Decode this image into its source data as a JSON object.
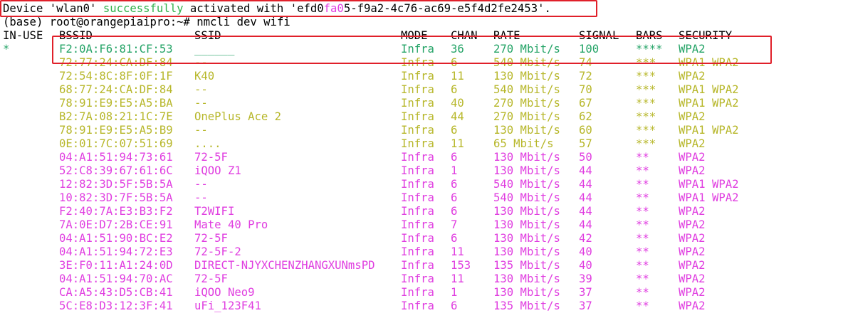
{
  "colors": {
    "default_text": "#000000",
    "success_green": "#2fb24a",
    "active_row_green": "#23a366",
    "weak_signal_yellow": "#b7b72a",
    "low_signal_magenta": "#e03ee0",
    "highlight_red": "#e0202a"
  },
  "terminal": {
    "status_line": {
      "prefix": "Device 'wlan0' ",
      "highlight_word": "successfully",
      "middle": " activated with 'efd0",
      "uuid_magenta": "fa0",
      "uuid_rest": "5-f9a2-4c76-ac69-e5f4d2fe2453'."
    },
    "prompt": "(base) root@orangepiaipro:~# nmcli dev wifi",
    "headers": [
      "IN-USE",
      "BSSID",
      "SSID",
      "MODE",
      "CHAN",
      "RATE",
      "SIGNAL",
      "BARS",
      "SECURITY"
    ],
    "rows": [
      {
        "inuse": "*",
        "bssid": "F2:0A:F6:81:CF:53",
        "ssid": "______",
        "mode": "Infra",
        "chan": "36",
        "rate": "270 Mbit/s",
        "signal": "100",
        "bars": "****",
        "security": "WPA2",
        "tone": "active"
      },
      {
        "inuse": "",
        "bssid": "72:77:24:CA:DF:84",
        "ssid": "--",
        "mode": "Infra",
        "chan": "6",
        "rate": "540 Mbit/s",
        "signal": "74",
        "bars": "***",
        "security": "WPA1 WPA2",
        "tone": "yellow"
      },
      {
        "inuse": "",
        "bssid": "72:54:8C:8F:0F:1F",
        "ssid": "K40",
        "mode": "Infra",
        "chan": "11",
        "rate": "130 Mbit/s",
        "signal": "72",
        "bars": "***",
        "security": "WPA2",
        "tone": "yellow"
      },
      {
        "inuse": "",
        "bssid": "68:77:24:CA:DF:84",
        "ssid": "--",
        "mode": "Infra",
        "chan": "6",
        "rate": "540 Mbit/s",
        "signal": "70",
        "bars": "***",
        "security": "WPA1 WPA2",
        "tone": "yellow"
      },
      {
        "inuse": "",
        "bssid": "78:91:E9:E5:A5:BA",
        "ssid": "--",
        "mode": "Infra",
        "chan": "40",
        "rate": "270 Mbit/s",
        "signal": "67",
        "bars": "***",
        "security": "WPA1 WPA2",
        "tone": "yellow"
      },
      {
        "inuse": "",
        "bssid": "B2:7A:08:21:1C:7E",
        "ssid": "OnePlus Ace 2",
        "mode": "Infra",
        "chan": "44",
        "rate": "270 Mbit/s",
        "signal": "62",
        "bars": "***",
        "security": "WPA2",
        "tone": "yellow"
      },
      {
        "inuse": "",
        "bssid": "78:91:E9:E5:A5:B9",
        "ssid": "--",
        "mode": "Infra",
        "chan": "6",
        "rate": "130 Mbit/s",
        "signal": "60",
        "bars": "***",
        "security": "WPA1 WPA2",
        "tone": "yellow"
      },
      {
        "inuse": "",
        "bssid": "0E:01:7C:07:51:69",
        "ssid": "....",
        "mode": "Infra",
        "chan": "11",
        "rate": "65 Mbit/s",
        "signal": "57",
        "bars": "***",
        "security": "WPA2",
        "tone": "yellow"
      },
      {
        "inuse": "",
        "bssid": "04:A1:51:94:73:61",
        "ssid": "72-5F",
        "mode": "Infra",
        "chan": "6",
        "rate": "130 Mbit/s",
        "signal": "50",
        "bars": "**",
        "security": "WPA2",
        "tone": "magenta"
      },
      {
        "inuse": "",
        "bssid": "52:C8:39:67:61:6C",
        "ssid": "iQOO Z1",
        "mode": "Infra",
        "chan": "1",
        "rate": "130 Mbit/s",
        "signal": "44",
        "bars": "**",
        "security": "WPA2",
        "tone": "magenta"
      },
      {
        "inuse": "",
        "bssid": "12:82:3D:5F:5B:5A",
        "ssid": "--",
        "mode": "Infra",
        "chan": "6",
        "rate": "540 Mbit/s",
        "signal": "44",
        "bars": "**",
        "security": "WPA1 WPA2",
        "tone": "magenta"
      },
      {
        "inuse": "",
        "bssid": "10:82:3D:7F:5B:5A",
        "ssid": "--",
        "mode": "Infra",
        "chan": "6",
        "rate": "540 Mbit/s",
        "signal": "44",
        "bars": "**",
        "security": "WPA1 WPA2",
        "tone": "magenta"
      },
      {
        "inuse": "",
        "bssid": "F2:40:7A:E3:B3:F2",
        "ssid": "T2WIFI",
        "mode": "Infra",
        "chan": "6",
        "rate": "130 Mbit/s",
        "signal": "44",
        "bars": "**",
        "security": "WPA2",
        "tone": "magenta"
      },
      {
        "inuse": "",
        "bssid": "7A:0E:D7:2B:CE:91",
        "ssid": "Mate 40 Pro",
        "mode": "Infra",
        "chan": "7",
        "rate": "130 Mbit/s",
        "signal": "44",
        "bars": "**",
        "security": "WPA2",
        "tone": "magenta"
      },
      {
        "inuse": "",
        "bssid": "04:A1:51:90:BC:E2",
        "ssid": "72-5F",
        "mode": "Infra",
        "chan": "6",
        "rate": "130 Mbit/s",
        "signal": "42",
        "bars": "**",
        "security": "WPA2",
        "tone": "magenta"
      },
      {
        "inuse": "",
        "bssid": "04:A1:51:94:72:E3",
        "ssid": "72-5F-2",
        "mode": "Infra",
        "chan": "11",
        "rate": "130 Mbit/s",
        "signal": "40",
        "bars": "**",
        "security": "WPA2",
        "tone": "magenta"
      },
      {
        "inuse": "",
        "bssid": "3E:F0:11:A1:24:0D",
        "ssid": "DIRECT-NJYXCHENZHANGXUNmsPD",
        "mode": "Infra",
        "chan": "153",
        "rate": "135 Mbit/s",
        "signal": "40",
        "bars": "**",
        "security": "WPA2",
        "tone": "magenta"
      },
      {
        "inuse": "",
        "bssid": "04:A1:51:94:70:AC",
        "ssid": "72-5F",
        "mode": "Infra",
        "chan": "11",
        "rate": "130 Mbit/s",
        "signal": "39",
        "bars": "**",
        "security": "WPA2",
        "tone": "magenta"
      },
      {
        "inuse": "",
        "bssid": "CA:A5:43:D5:CB:41",
        "ssid": "iQOO Neo9",
        "mode": "Infra",
        "chan": "1",
        "rate": "130 Mbit/s",
        "signal": "37",
        "bars": "**",
        "security": "WPA2",
        "tone": "magenta"
      },
      {
        "inuse": "",
        "bssid": "5C:E8:D3:12:3F:41",
        "ssid": "uFi_123F41",
        "mode": "Infra",
        "chan": "6",
        "rate": "135 Mbit/s",
        "signal": "37",
        "bars": "**",
        "security": "WPA2",
        "tone": "magenta"
      }
    ]
  }
}
